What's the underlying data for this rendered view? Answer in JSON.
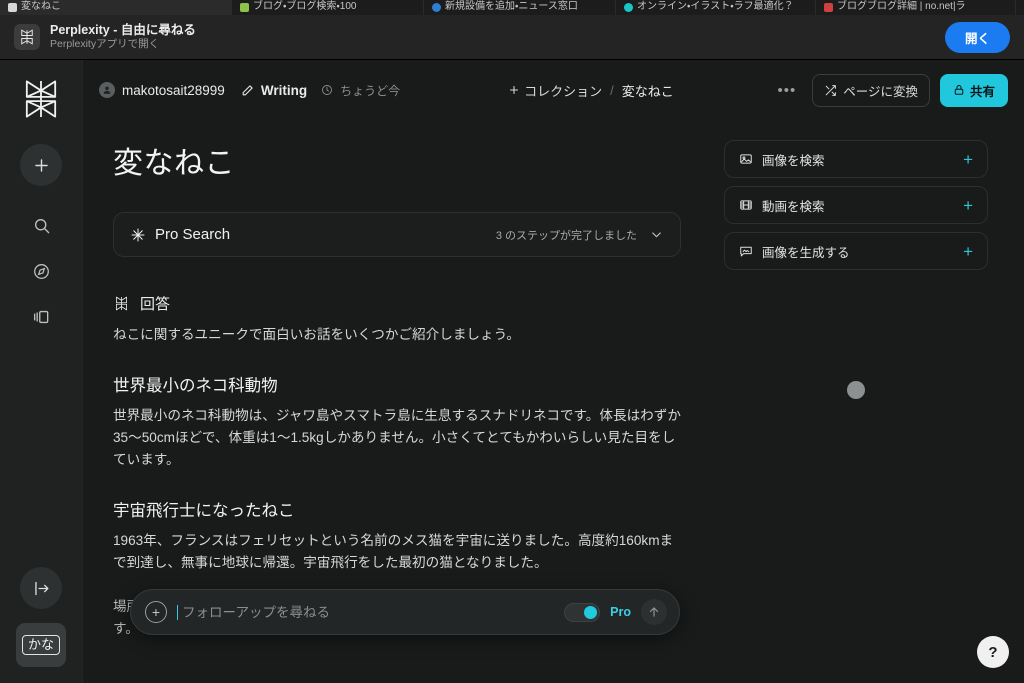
{
  "browser": {
    "tabs": [
      {
        "label": "変なねこ",
        "favicon": "#d8d8d8",
        "active": true
      },
      {
        "label": "ブログ・ブログ検索・100",
        "favicon": "#8bc34a",
        "active": false
      },
      {
        "label": "新規設備を追加・ニュース窓口",
        "favicon": "#2f7fd0",
        "active": false
      },
      {
        "label": "オンライン・イラスト・ラフ最適化？",
        "favicon": "#19c6c6",
        "active": false
      },
      {
        "label": "ブログブログ詳細 | no.net|ラ",
        "favicon": "#d04040",
        "active": false
      }
    ]
  },
  "banner": {
    "title": "Perplexity - 自由に尋ねる",
    "subtitle": "Perplexityアプリで開く",
    "open_label": "開く",
    "logo_icon": "perplexity-logo-icon",
    "accent": "#1a7cf0"
  },
  "rail": {
    "logo_icon": "perplexity-logo-icon",
    "items": [
      {
        "name": "new-thread",
        "icon": "plus-icon"
      },
      {
        "name": "search",
        "icon": "search-icon"
      },
      {
        "name": "discover",
        "icon": "compass-icon"
      },
      {
        "name": "library",
        "icon": "library-icon"
      }
    ],
    "bottom": {
      "name": "expand-sidebar",
      "icon": "arrow-right-from-bar-icon"
    },
    "ime": {
      "label": "かな"
    }
  },
  "toolbar": {
    "username": "makotosait28999",
    "avatar_icon": "user-icon",
    "writing_label": "Writing",
    "writing_icon": "pencil-icon",
    "time_label": "ちょうど今",
    "time_icon": "clock-icon",
    "collection_label": "コレクション",
    "collection_icon": "plus-icon",
    "separator": "/",
    "breadcrumb": "変なねこ",
    "more_label": "•••",
    "convert_label": "ページに変換",
    "convert_icon": "shuffle-icon",
    "share_label": "共有",
    "share_icon": "lock-icon",
    "share_accent": "#20c7dd"
  },
  "main": {
    "title": "変なねこ",
    "pro_search": {
      "label": "Pro Search",
      "icon": "sparkle-icon",
      "steps_label": "3 のステップが完了しました",
      "chevron_icon": "chevron-down-icon"
    },
    "answer": {
      "label": "回答",
      "icon": "perplexity-logo-icon",
      "intro": "ねこに関するユニークで面白いお話をいくつかご紹介しましょう。",
      "sections": [
        {
          "heading": "世界最小のネコ科動物",
          "body": "世界最小のネコ科動物は、ジャワ島やスマトラ島に生息するスナドリネコです。体長はわずか35〜50cmほどで、体重は1〜1.5kgしかありません。小さくてとてもかわいらしい見た目をしています。"
        },
        {
          "heading": "宇宙飛行士になったねこ",
          "body": "1963年、フランスはフェリセットという名前のメス猫を宇宙に送りました。高度約160kmまで到達し、無事に地球に帰還。宇宙飛行をした最初の猫となりました。"
        }
      ],
      "trailing_text": "場所などをしっかり記憶しているのですね。長期記憶は犬の方が優れているとされています。"
    }
  },
  "right_panel": {
    "actions": [
      {
        "label": "画像を検索",
        "icon": "image-icon",
        "plus": "+"
      },
      {
        "label": "動画を検索",
        "icon": "film-icon",
        "plus": "+"
      },
      {
        "label": "画像を生成する",
        "icon": "image-generate-icon",
        "plus": "+"
      }
    ],
    "loading_indicator": "spinner-dot"
  },
  "followup": {
    "placeholder": "フォローアップを尋ねる",
    "value": "",
    "plus_icon": "plus-circle-icon",
    "pro_label": "Pro",
    "pro_enabled": true,
    "send_icon": "arrow-up-icon",
    "accent": "#22cadf"
  },
  "help": {
    "label": "?"
  }
}
